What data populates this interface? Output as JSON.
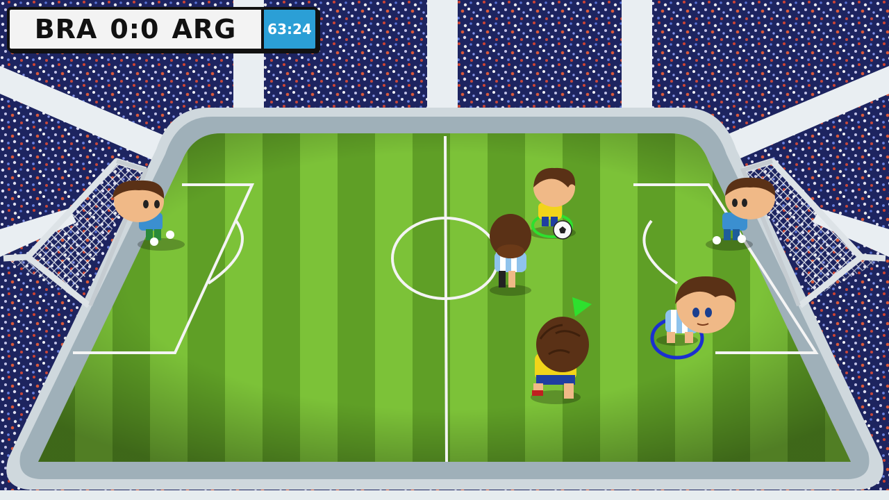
{
  "hud": {
    "home_team": "BRA",
    "home_score": "0",
    "separator": ":",
    "away_score": "0",
    "away_team": "ARG",
    "match_time": "63:24"
  },
  "colors": {
    "pitch_light": "#7fc43a",
    "pitch_dark": "#5aa024",
    "wall": "#dfe6ea",
    "brazil_shirt": "#f2d41a",
    "argentina_shirt": "#8fc3ec",
    "keeper_shirt": "#3b8fd0",
    "selected_ring": "#1a2fd0",
    "ball_ring": "#2ee02e",
    "timer_bg": "#2b9fd6"
  },
  "players": [
    {
      "team": "home",
      "role": "keeper"
    },
    {
      "team": "away",
      "role": "keeper"
    },
    {
      "team": "home",
      "role": "field",
      "has_ball": true
    },
    {
      "team": "away",
      "role": "field"
    },
    {
      "team": "home",
      "role": "field",
      "controlled": true
    },
    {
      "team": "away",
      "role": "field",
      "selected": true
    }
  ]
}
